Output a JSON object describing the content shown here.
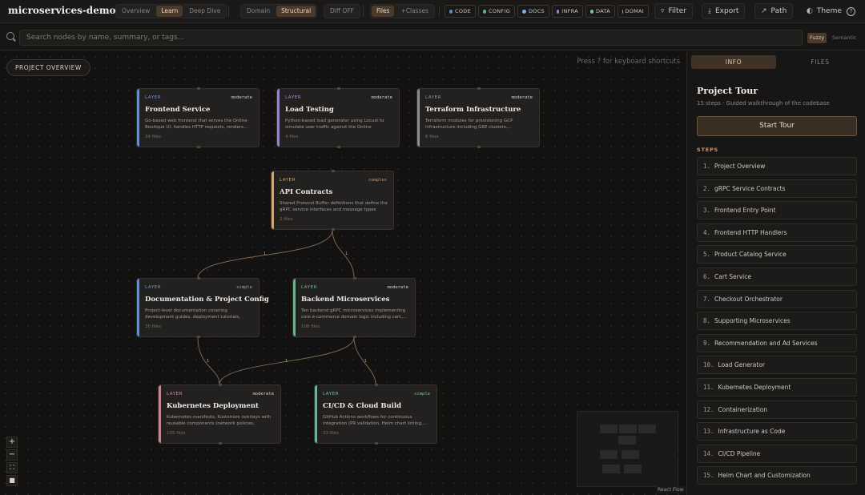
{
  "app": {
    "title": "microservices-demo"
  },
  "persona_modes": [
    {
      "label": "Overview",
      "active": false
    },
    {
      "label": "Learn",
      "active": true
    },
    {
      "label": "Deep Dive",
      "active": false
    }
  ],
  "view_modes": [
    {
      "label": "Domain",
      "active": false
    },
    {
      "label": "Structural",
      "active": true
    }
  ],
  "diff_toggle": {
    "label": "Diff OFF"
  },
  "detail_modes": [
    {
      "label": "Files",
      "active": true
    },
    {
      "label": "+Classes",
      "active": false
    }
  ],
  "type_filters": [
    {
      "label": "CODE",
      "color": "#5b8fd6"
    },
    {
      "label": "CONFIG",
      "color": "#4fb8ad"
    },
    {
      "label": "DOCS",
      "color": "#7fb4e8"
    },
    {
      "label": "INFRA",
      "color": "#9a7fd6"
    },
    {
      "label": "DATA",
      "color": "#6bcf9a"
    },
    {
      "label": "DOMAI",
      "color": "#d67f8a"
    }
  ],
  "toolbar": {
    "filter": "Filter",
    "export": "Export",
    "path": "Path",
    "theme": "Theme"
  },
  "search": {
    "placeholder": "Search nodes by name, summary, or tags...",
    "value": "",
    "fuzzy": "Fuzzy",
    "semantic": "Semantic"
  },
  "canvas": {
    "overview_button": "PROJECT OVERVIEW",
    "shortcut_hint": "Press ? for keyboard shortcuts",
    "attribution": "React Flow",
    "nodes": [
      {
        "kind": "LAYER",
        "complexity": "moderate",
        "name": "Frontend Service",
        "summary": "Go-based web frontend that serves the Online Boutique UI, handles HTTP requests, renders...",
        "files": "34 files",
        "accent": "#5b8fd6"
      },
      {
        "kind": "LAYER",
        "complexity": "moderate",
        "name": "Load Testing",
        "summary": "Python-based load generator using Locust to simulate user traffic against the Online Boutique...",
        "files": "4 files",
        "accent": "#9a7fd6"
      },
      {
        "kind": "LAYER",
        "complexity": "moderate",
        "name": "Terraform Infrastructure",
        "summary": "Terraform modules for provisioning GCP infrastructure including GKE clusters,...",
        "files": "6 files",
        "accent": "#8a8a9a"
      },
      {
        "kind": "LAYER",
        "complexity": "complex",
        "name": "API Contracts",
        "summary": "Shared Protocol Buffer definitions that define the gRPC service interfaces and message types use...",
        "files": "2 files",
        "accent": "#d4a46a"
      },
      {
        "kind": "LAYER",
        "complexity": "simple",
        "name": "Documentation & Project Config",
        "summary": "Project-level documentation covering development guides, deployment tutorials, relea...",
        "files": "20 files",
        "accent": "#5b8fd6"
      },
      {
        "kind": "LAYER",
        "complexity": "moderate",
        "name": "Backend Microservices",
        "summary": "Ten backend gRPC microservices implementing core e-commerce domain logic including cart,...",
        "files": "108 files",
        "accent": "#5fb88a"
      },
      {
        "kind": "LAYER",
        "complexity": "moderate",
        "name": "Kubernetes Deployment",
        "summary": "Kubernetes manifests, Kustomize overlays with reusable components (network policies, service...",
        "files": "105 files",
        "accent": "#d67f9a"
      },
      {
        "kind": "LAYER",
        "complexity": "simple",
        "name": "CI/CD & Cloud Build",
        "summary": "GitHub Actions workflows for continuous integration (PR validation, Helm chart linting,...",
        "files": "33 files",
        "accent": "#5fb8a0"
      }
    ],
    "edge_labels": [
      "1",
      "1",
      "1",
      "1",
      "1",
      "1"
    ]
  },
  "panel": {
    "tabs": [
      {
        "label": "INFO",
        "active": true
      },
      {
        "label": "FILES",
        "active": false
      }
    ],
    "tour_title": "Project Tour",
    "tour_subtitle": "15 steps · Guided walkthrough of the codebase",
    "start_button": "Start Tour",
    "steps_heading": "STEPS",
    "steps": [
      {
        "num": "1.",
        "label": "Project Overview"
      },
      {
        "num": "2.",
        "label": "gRPC Service Contracts"
      },
      {
        "num": "3.",
        "label": "Frontend Entry Point"
      },
      {
        "num": "4.",
        "label": "Frontend HTTP Handlers"
      },
      {
        "num": "5.",
        "label": "Product Catalog Service"
      },
      {
        "num": "6.",
        "label": "Cart Service"
      },
      {
        "num": "7.",
        "label": "Checkout Orchestrator"
      },
      {
        "num": "8.",
        "label": "Supporting Microservices"
      },
      {
        "num": "9.",
        "label": "Recommendation and Ad Services"
      },
      {
        "num": "10.",
        "label": "Load Generator"
      },
      {
        "num": "11.",
        "label": "Kubernetes Deployment"
      },
      {
        "num": "12.",
        "label": "Containerization"
      },
      {
        "num": "13.",
        "label": "Infrastructure as Code"
      },
      {
        "num": "14.",
        "label": "CI/CD Pipeline"
      },
      {
        "num": "15.",
        "label": "Helm Chart and Customization"
      }
    ]
  }
}
